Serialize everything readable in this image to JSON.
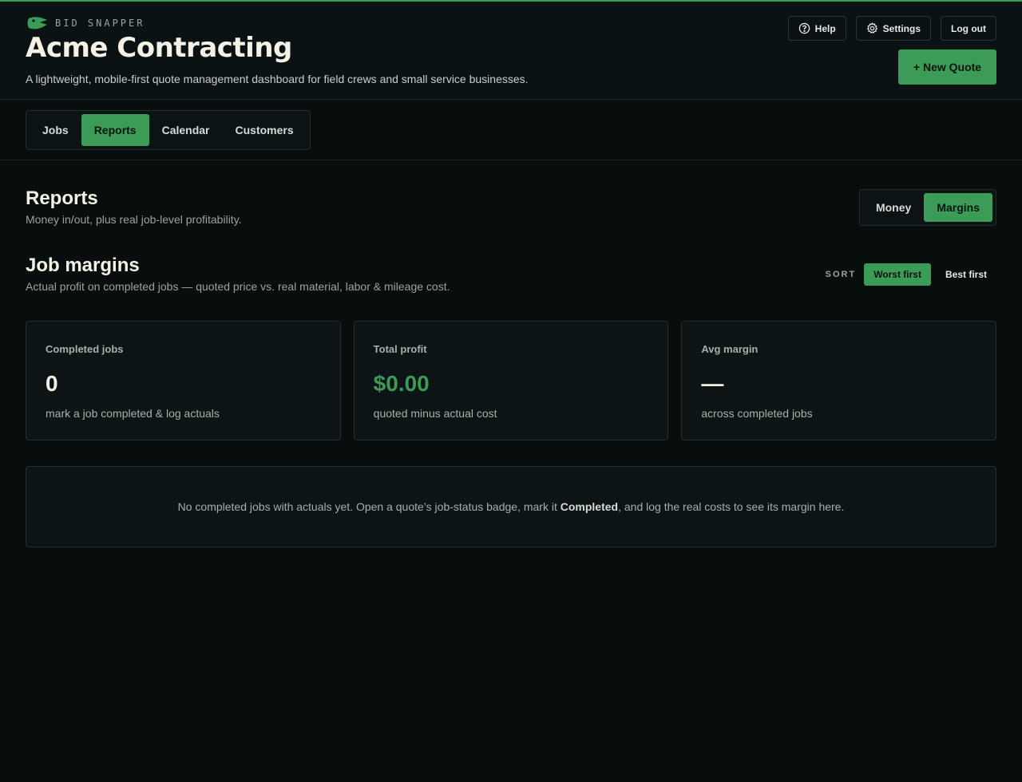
{
  "brand": {
    "name": "BID SNAPPER",
    "logo_icon": "snapper-logo-icon",
    "accent_color": "#3c9b56"
  },
  "header": {
    "company": "Acme Contracting",
    "tagline": "A lightweight, mobile-first quote management dashboard for field crews and small service businesses.",
    "help_label": "Help",
    "settings_label": "Settings",
    "logout_label": "Log out",
    "new_quote_label": "+ New Quote"
  },
  "nav": {
    "tabs": [
      {
        "label": "Jobs",
        "active": false
      },
      {
        "label": "Reports",
        "active": true
      },
      {
        "label": "Calendar",
        "active": false
      },
      {
        "label": "Customers",
        "active": false
      }
    ]
  },
  "reports": {
    "title": "Reports",
    "subtitle": "Money in/out, plus real job-level profitability.",
    "views": [
      {
        "label": "Money",
        "active": false
      },
      {
        "label": "Margins",
        "active": true
      }
    ]
  },
  "margins": {
    "title": "Job margins",
    "subtitle": "Actual profit on completed jobs — quoted price vs. real material, labor & mileage cost.",
    "sort_label": "SORT",
    "sort_options": [
      {
        "label": "Worst first",
        "active": true
      },
      {
        "label": "Best first",
        "active": false
      }
    ],
    "cards": [
      {
        "label": "Completed jobs",
        "value": "0",
        "note": "mark a job completed & log actuals"
      },
      {
        "label": "Total profit",
        "value": "$0.00",
        "note": "quoted minus actual cost"
      },
      {
        "label": "Avg margin",
        "value": "—",
        "note": "across completed jobs"
      }
    ],
    "empty": {
      "before": "No completed jobs with actuals yet. Open a quote’s job-status badge, mark it ",
      "strong": "Completed",
      "after": ", and log the real costs to see its margin here."
    }
  }
}
